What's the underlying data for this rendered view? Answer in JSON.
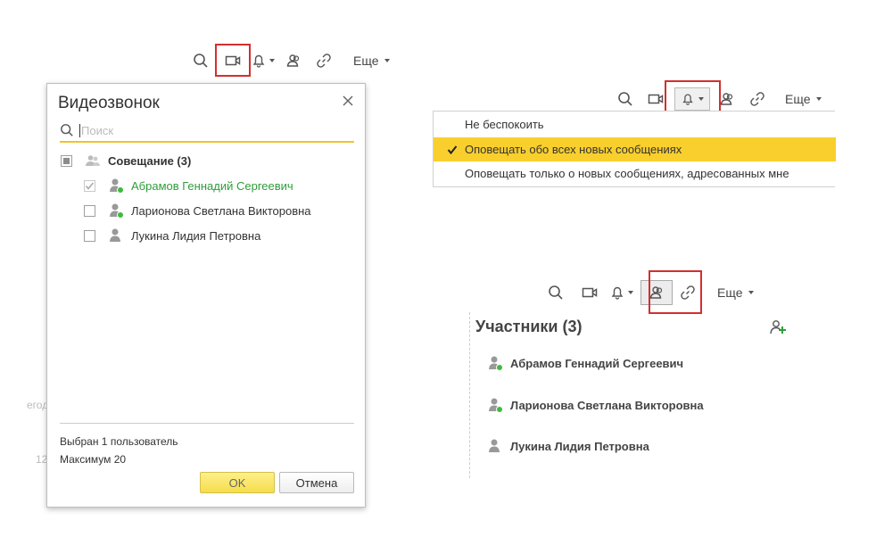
{
  "toolbar": {
    "more_label": "Еще"
  },
  "video_call_dialog": {
    "title": "Видеозвонок",
    "search_placeholder": "Поиск",
    "group": {
      "label": "Совещание (3)"
    },
    "members": [
      {
        "name": "Абрамов Геннадий Сергеевич",
        "checked": true,
        "online": true
      },
      {
        "name": "Ларионова Светлана Викторовна",
        "checked": false,
        "online": true
      },
      {
        "name": "Лукина Лидия Петровна",
        "checked": false,
        "online": false
      }
    ],
    "status_selected": "Выбран 1 пользователь",
    "status_max": "Максимум 20",
    "ok_label": "OK",
    "cancel_label": "Отмена"
  },
  "notify_menu": {
    "items": [
      {
        "label": "Не беспокоить",
        "selected": false
      },
      {
        "label": "Оповещать обо всех новых сообщениях",
        "selected": true
      },
      {
        "label": "Оповещать только о новых сообщениях, адресованных мне",
        "selected": false
      }
    ]
  },
  "participants": {
    "title": "Участники (3)",
    "items": [
      {
        "name": "Абрамов Геннадий Сергеевич",
        "online": true
      },
      {
        "name": "Ларионова Светлана Викторовна",
        "online": true
      },
      {
        "name": "Лукина Лидия Петровна",
        "online": false
      }
    ]
  },
  "background_fragments": {
    "left_text_1": "егод",
    "left_text_2": "12"
  },
  "colors": {
    "highlight_red": "#d32f2f",
    "menu_active": "#f9cf2d",
    "online_green": "#3dbb3d",
    "ok_yellow": "#f6dd4c"
  }
}
